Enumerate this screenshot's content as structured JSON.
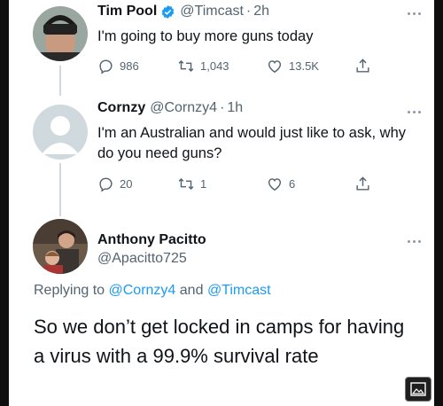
{
  "tweets": [
    {
      "name": "Tim Pool",
      "handle": "@Timcast",
      "time": "2h",
      "text": "I'm going to buy more guns today",
      "verified": true,
      "replies": "986",
      "retweets": "1,043",
      "likes": "13.5K"
    },
    {
      "name": "Cornzy",
      "handle": "@Cornzy4",
      "time": "1h",
      "text": "I'm an Australian and would just like to ask, why do you need guns?",
      "replies": "20",
      "retweets": "1",
      "likes": "6"
    }
  ],
  "main_tweet": {
    "name": "Anthony Pacitto",
    "handle": "@Apacitto725",
    "replying_prefix": "Replying to",
    "replying_user1": "@Cornzy4",
    "replying_and": "and",
    "replying_user2": "@Timcast",
    "text": "So we don’t get locked in camps for having a virus with a 99.9% survival rate"
  },
  "icons": {
    "reply": "reply-icon",
    "retweet": "retweet-icon",
    "like": "heart-icon",
    "share": "share-icon",
    "more": "more-icon",
    "media": "image-icon"
  },
  "colors": {
    "link": "#1d9bf0",
    "verified": "#1d9bf0",
    "secondary_text": "#536471"
  }
}
